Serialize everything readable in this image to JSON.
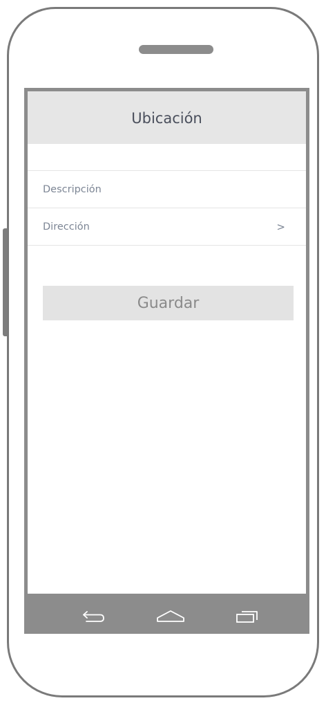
{
  "header": {
    "title": "Ubicación"
  },
  "form": {
    "fields": [
      {
        "label": "Descripción"
      },
      {
        "label": "Dirección",
        "chevron": ">"
      }
    ],
    "save_label": "Guardar"
  },
  "nav": {
    "icons": [
      "back-icon",
      "home-icon",
      "recent-apps-icon"
    ]
  },
  "colors": {
    "title_bar": "#e6e6e6",
    "button": "#e3e3e3",
    "nav_bar": "#8c8c8c",
    "frame": "#7a7a7a"
  }
}
